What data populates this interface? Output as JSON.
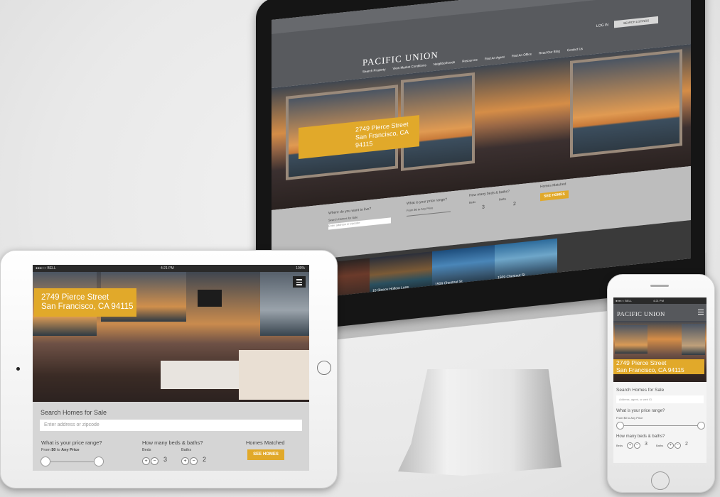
{
  "brand": "PACIFIC UNION",
  "listing": {
    "address_line1": "2749 Pierce Street",
    "address_line2": "San Francisco, CA 94115"
  },
  "desktop": {
    "login": "LOG IN",
    "cta": "SEARCH LISTINGS",
    "nav": [
      "Search Property",
      "View Market Conditions",
      "Neighborhoods",
      "Resources",
      "Find An Agent",
      "Find An Office",
      "Read Our Blog",
      "Contact Us"
    ],
    "search_where": "Where do you want to live?",
    "search_sub": "Search Homes for Sale",
    "search_placeholder": "Enter address or zipcode",
    "price_q": "What is your price range?",
    "price_range": "From $0 to Any Price",
    "beds_q": "How many beds & baths?",
    "beds_label": "Beds",
    "baths_label": "Baths",
    "beds_value": "3",
    "baths_value": "2",
    "matched_label": "Homes Matched",
    "see_homes": "SEE HOMES",
    "gallery": [
      {
        "title": "",
        "sub": ""
      },
      {
        "title": "10 Sleepy Hollow Lane",
        "sub": "Orinda"
      },
      {
        "title": "1509 Chestnut St",
        "sub": "San Francisco"
      },
      {
        "title": "1509 Chestnut St",
        "sub": "San Francisco"
      }
    ]
  },
  "tablet": {
    "carrier": "●●●○○ BELL",
    "time": "4:21 PM",
    "battery": "100%",
    "search_title": "Search Homes for Sale",
    "search_placeholder": "Enter address or zipcode",
    "price_q": "What is your price range?",
    "price_from": "From",
    "price_min": "$0",
    "price_to": "to",
    "price_max": "Any Price",
    "beds_q": "How many beds & baths?",
    "beds_label": "Beds",
    "baths_label": "Baths",
    "beds_value": "3",
    "baths_value": "2",
    "matched_label": "Homes Matched",
    "see_homes": "SEE HOMES"
  },
  "phone": {
    "carrier": "●●●○○ BELL",
    "time": "4:21 PM",
    "search_title": "Search Homes for Sale",
    "search_placeholder": "Address, agent, or web ID",
    "price_q": "What is your price range?",
    "price_range": "From $0 to Any Price",
    "beds_q": "How many beds & baths?",
    "beds_label": "Beds",
    "baths_label": "Baths",
    "beds_value": "3",
    "baths_value": "2"
  },
  "colors": {
    "accent": "#e1a92a",
    "header": "#585a5e",
    "panel": "#d5d5d5"
  }
}
